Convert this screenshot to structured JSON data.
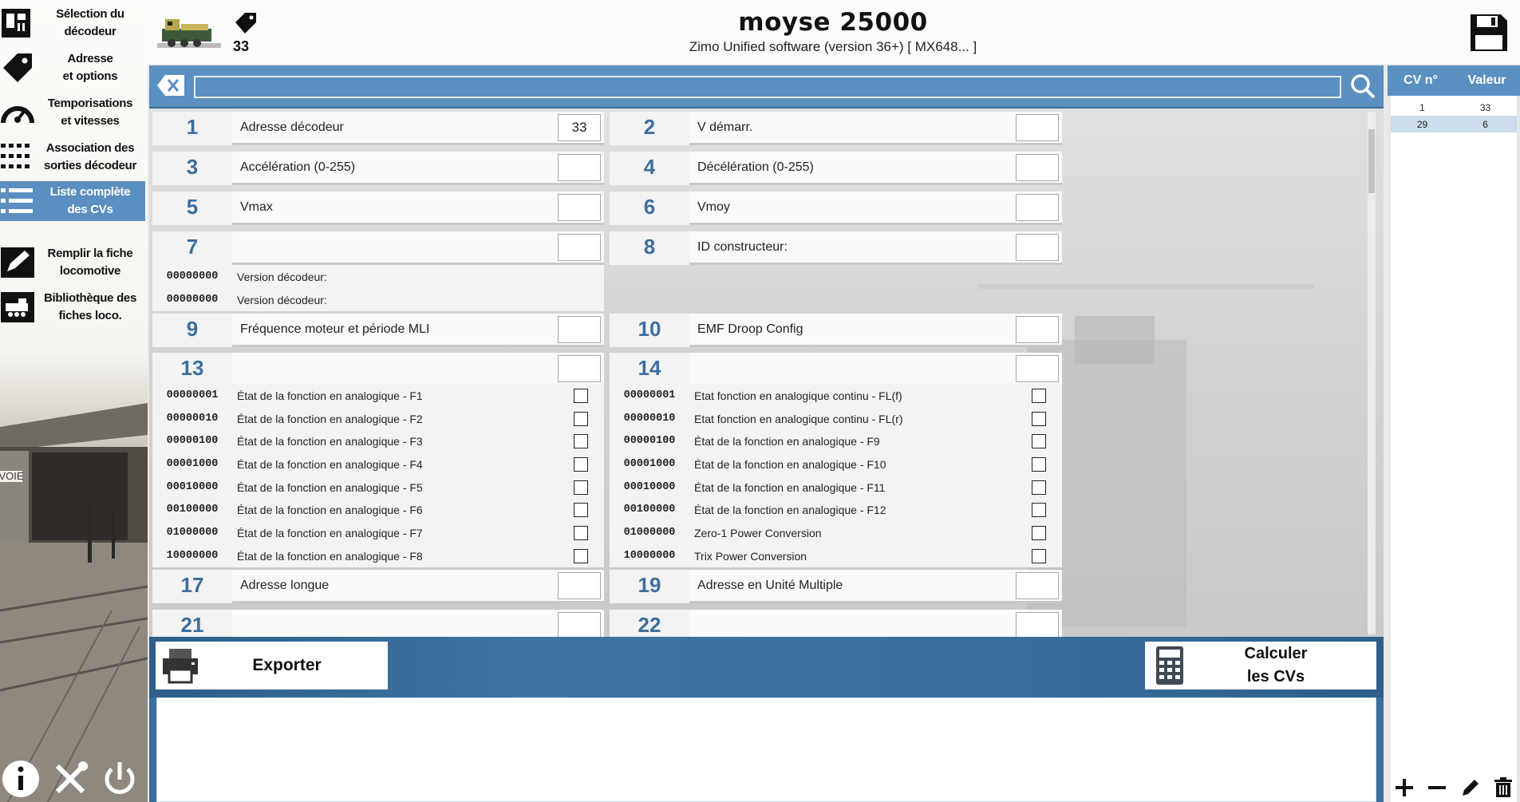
{
  "sidebar": {
    "items": [
      {
        "label": "Sélection du\ndécodeur",
        "icon": "decoder-chip-icon"
      },
      {
        "label": "Adresse\net options",
        "icon": "tag-icon"
      },
      {
        "label": "Temporisations\net vitesses",
        "icon": "speedometer-icon"
      },
      {
        "label": "Association des\nsorties décodeur",
        "icon": "grid-dots-icon"
      },
      {
        "label": "Liste complète\ndes CVs",
        "icon": "list-icon",
        "active": true
      },
      {
        "label": "Remplir la fiche\nlocomotive",
        "icon": "pencil-icon"
      },
      {
        "label": "Bibliothèque des\nfiches loco.",
        "icon": "locomotive-icon"
      }
    ],
    "bottom_icons": [
      "info-icon",
      "tools-icon",
      "power-icon"
    ],
    "scene_sign": "VOIE"
  },
  "header": {
    "address": "33",
    "title": "moyse 25000",
    "subtitle": "Zimo Unified software (version 36+) [ MX648... ]"
  },
  "search": {
    "value": ""
  },
  "cv_rows": [
    {
      "num": "1",
      "label": "Adresse décodeur",
      "value": "33"
    },
    {
      "num": "2",
      "label": "V démarr.",
      "value": ""
    },
    {
      "num": "3",
      "label": "Accélération (0-255)",
      "value": ""
    },
    {
      "num": "4",
      "label": "Décélération (0-255)",
      "value": ""
    },
    {
      "num": "5",
      "label": "Vmax",
      "value": ""
    },
    {
      "num": "6",
      "label": "Vmoy",
      "value": ""
    },
    {
      "num": "7",
      "label": "",
      "value": ""
    },
    {
      "num": "8",
      "label": "ID constructeur:",
      "value": ""
    },
    {
      "num": "9",
      "label": "Fréquence moteur et période MLI",
      "value": ""
    },
    {
      "num": "10",
      "label": "EMF Droop Config",
      "value": ""
    },
    {
      "num": "13",
      "label": "",
      "value": ""
    },
    {
      "num": "14",
      "label": "",
      "value": ""
    },
    {
      "num": "17",
      "label": "Adresse longue",
      "value": ""
    },
    {
      "num": "19",
      "label": "Adresse en Unité Multiple",
      "value": ""
    },
    {
      "num": "21",
      "label": "",
      "value": ""
    },
    {
      "num": "22",
      "label": "",
      "value": ""
    }
  ],
  "version_rows": [
    {
      "bits": "00000000",
      "label": "Version décodeur:"
    },
    {
      "bits": "00000000",
      "label": "Version décodeur:"
    }
  ],
  "cv13_bits": [
    {
      "bits": "00000001",
      "label": "État de la fonction en analogique - F1"
    },
    {
      "bits": "00000010",
      "label": "État de la fonction en analogique - F2"
    },
    {
      "bits": "00000100",
      "label": "État de la fonction en analogique - F3"
    },
    {
      "bits": "00001000",
      "label": "État de la fonction en analogique - F4"
    },
    {
      "bits": "00010000",
      "label": "État de la fonction en analogique - F5"
    },
    {
      "bits": "00100000",
      "label": "État de la fonction en analogique - F6"
    },
    {
      "bits": "01000000",
      "label": "État de la fonction en analogique - F7"
    },
    {
      "bits": "10000000",
      "label": "État de la fonction en analogique - F8"
    }
  ],
  "cv14_bits": [
    {
      "bits": "00000001",
      "label": "Etat fonction en analogique continu - FL(f)"
    },
    {
      "bits": "00000010",
      "label": "Etat fonction en analogique continu - FL(r)"
    },
    {
      "bits": "00000100",
      "label": "État de la fonction en analogique - F9"
    },
    {
      "bits": "00001000",
      "label": "État de la fonction en analogique - F10"
    },
    {
      "bits": "00010000",
      "label": "État de la fonction en analogique - F11"
    },
    {
      "bits": "00100000",
      "label": "État de la fonction en analogique - F12"
    },
    {
      "bits": "01000000",
      "label": "Zero-1 Power Conversion"
    },
    {
      "bits": "10000000",
      "label": "Trix Power Conversion"
    }
  ],
  "actions": {
    "export_label": "Exporter",
    "calculate_label": "Calculer\nles CVs"
  },
  "cv_table": {
    "headers": [
      "CV n°",
      "Valeur"
    ],
    "rows": [
      {
        "cv": "1",
        "value": "33",
        "selected": false
      },
      {
        "cv": "29",
        "value": "6",
        "selected": true
      }
    ],
    "tools": [
      "add-icon",
      "remove-icon",
      "edit-icon",
      "trash-icon"
    ]
  },
  "colors": {
    "accent": "#5a8fc1",
    "cv_number": "#3d6e9e",
    "panel_dark": "#3a6e9c"
  }
}
